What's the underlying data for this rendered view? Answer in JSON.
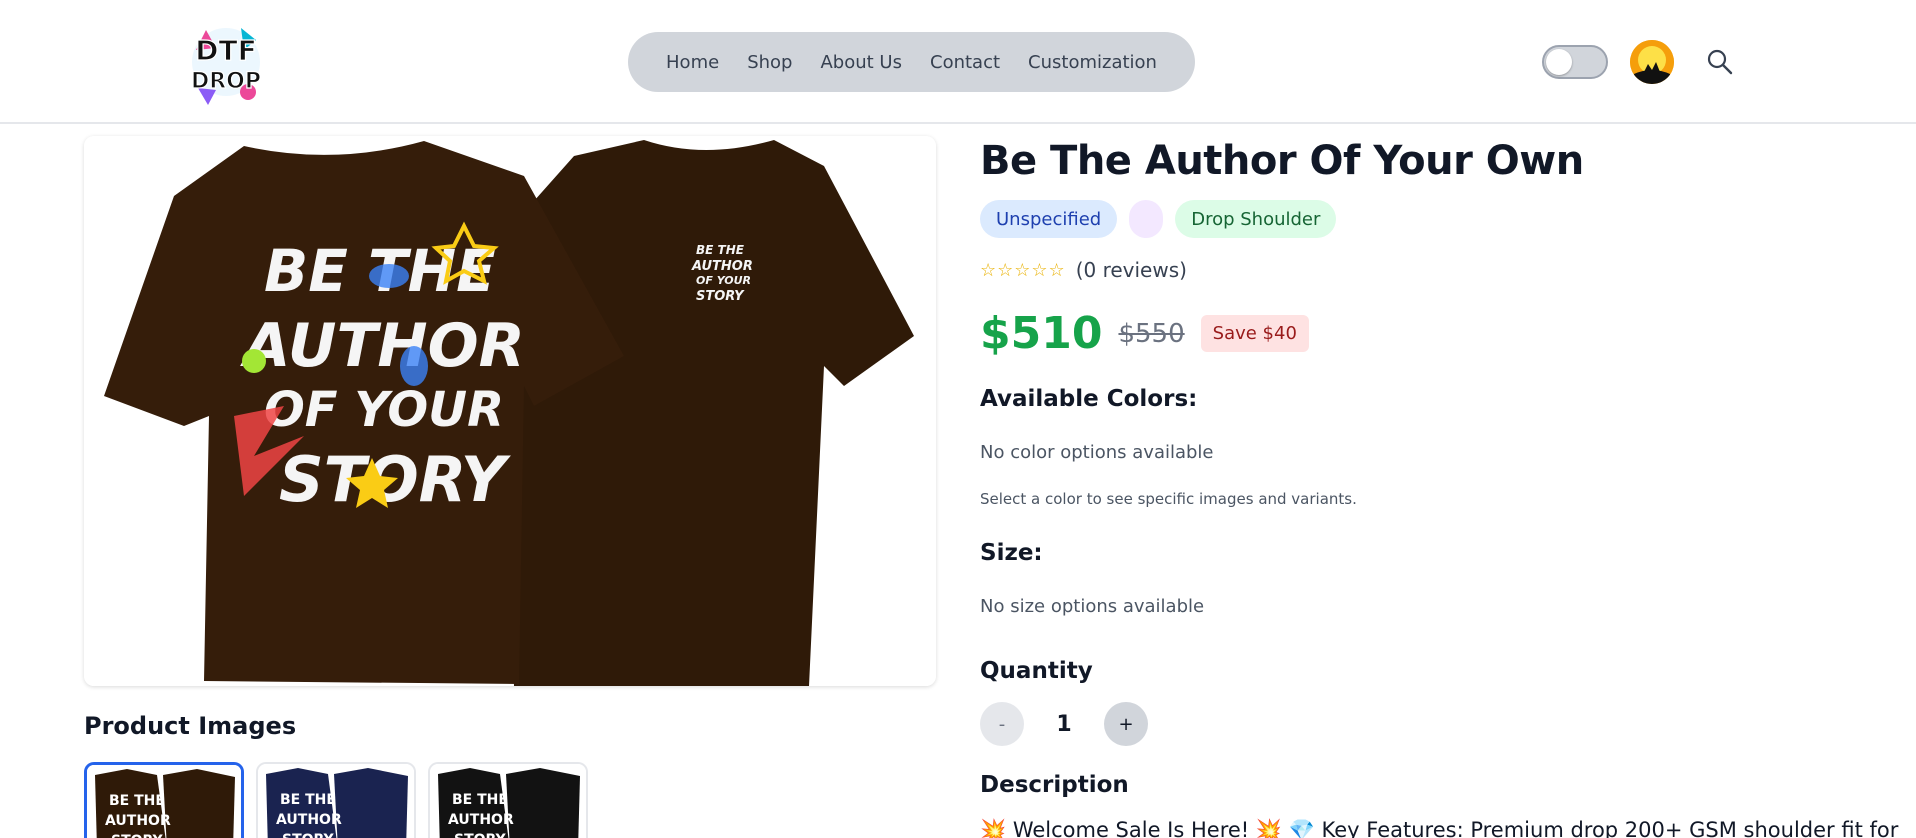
{
  "header": {
    "logo_text": "DTF DROP",
    "nav": [
      "Home",
      "Shop",
      "About Us",
      "Contact",
      "Customization"
    ],
    "theme_toggle_on": false,
    "icons": {
      "search": "search-icon",
      "avatar": "avatar"
    }
  },
  "gallery": {
    "product_images_label": "Product Images",
    "thumbnails": [
      {
        "color": "#2f1a08",
        "selected": true
      },
      {
        "color": "#1a2350",
        "selected": false
      },
      {
        "color": "#121212",
        "selected": false
      }
    ],
    "main_color": "#2f1a08"
  },
  "product": {
    "title": "Be The Author Of Your Own",
    "badges": {
      "size": "Unspecified",
      "color": "",
      "fit": "Drop Shoulder"
    },
    "rating": {
      "stars": "☆☆☆☆☆",
      "reviews": "(0 reviews)"
    },
    "price": "$510",
    "old_price": "$550",
    "save": "Save $40",
    "colors_label": "Available Colors:",
    "colors_empty": "No color options available",
    "colors_hint": "Select a color to see specific images and variants.",
    "size_label": "Size:",
    "size_empty": "No size options available",
    "quantity_label": "Quantity",
    "quantity": "1",
    "minus": "-",
    "plus": "+",
    "description_label": "Description",
    "description_text": "💥 Welcome Sale Is Here! 💥  💎 Key Features: Premium drop 200+ GSM shoulder fit for"
  }
}
